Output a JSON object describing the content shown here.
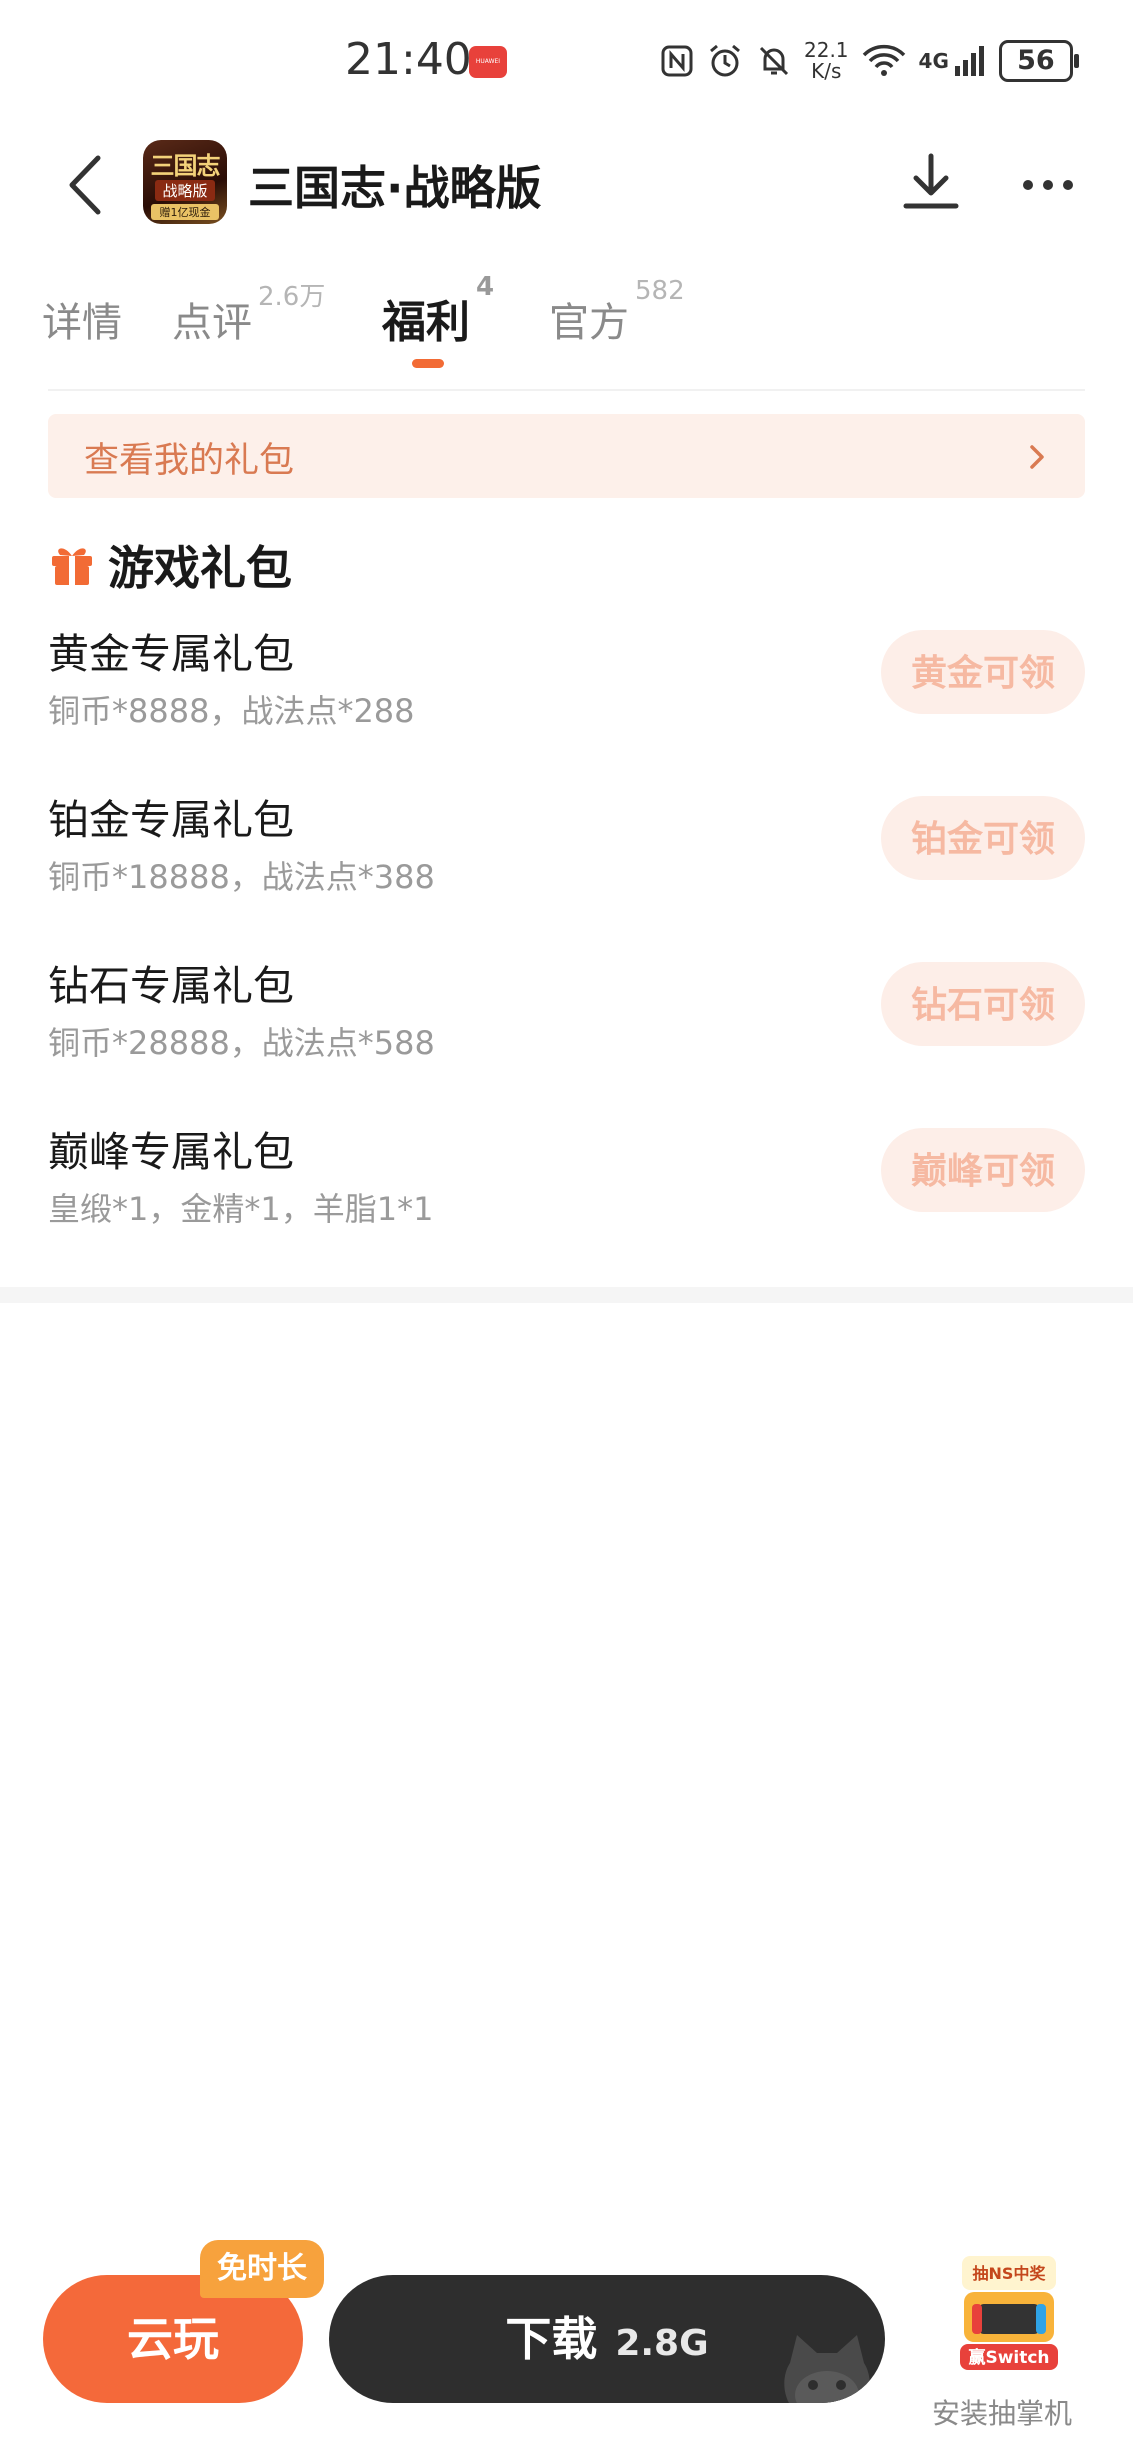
{
  "status_bar": {
    "time": "21:40",
    "huawei_badge": "HUAWEI",
    "net_speed_value": "22.1",
    "net_speed_unit": "K/s",
    "network": "4G",
    "battery": "56"
  },
  "header": {
    "icon_text_top": "三国志",
    "icon_text_mid": "战略版",
    "icon_text_bottom": "赠1亿现金",
    "title": "三国志·战略版"
  },
  "tabs": [
    {
      "label": "详情",
      "badge": ""
    },
    {
      "label": "点评",
      "badge": "2.6万"
    },
    {
      "label": "福利",
      "badge": "4"
    },
    {
      "label": "官方",
      "badge": "582"
    }
  ],
  "active_tab": "福利",
  "my_gifts": {
    "label": "查看我的礼包"
  },
  "section": {
    "title": "游戏礼包"
  },
  "gifts": [
    {
      "name": "黄金专属礼包",
      "desc": "铜币*8888，战法点*288",
      "button": "黄金可领"
    },
    {
      "name": "铂金专属礼包",
      "desc": "铜币*18888，战法点*388",
      "button": "铂金可领"
    },
    {
      "name": "钻石专属礼包",
      "desc": "铜币*28888，战法点*588",
      "button": "钻石可领"
    },
    {
      "name": "巅峰专属礼包",
      "desc": "皇缎*1，金精*1，羊脂1*1",
      "button": "巅峰可领"
    }
  ],
  "bottom_bar": {
    "cloud_play": "云玩",
    "free_tag": "免时长",
    "download": "下载",
    "download_size": "2.8G",
    "promo_top": "抽NS中奖",
    "promo_badge": "赢Switch",
    "promo_label": "安装抽掌机"
  },
  "colors": {
    "accent": "#f26b35",
    "cloud_button": "#f4693a",
    "download_button": "#2e2e2e",
    "banner_bg": "#fdf0ea",
    "gift_button_bg": "#fdeee8",
    "gift_button_text": "#f6b9a2"
  }
}
